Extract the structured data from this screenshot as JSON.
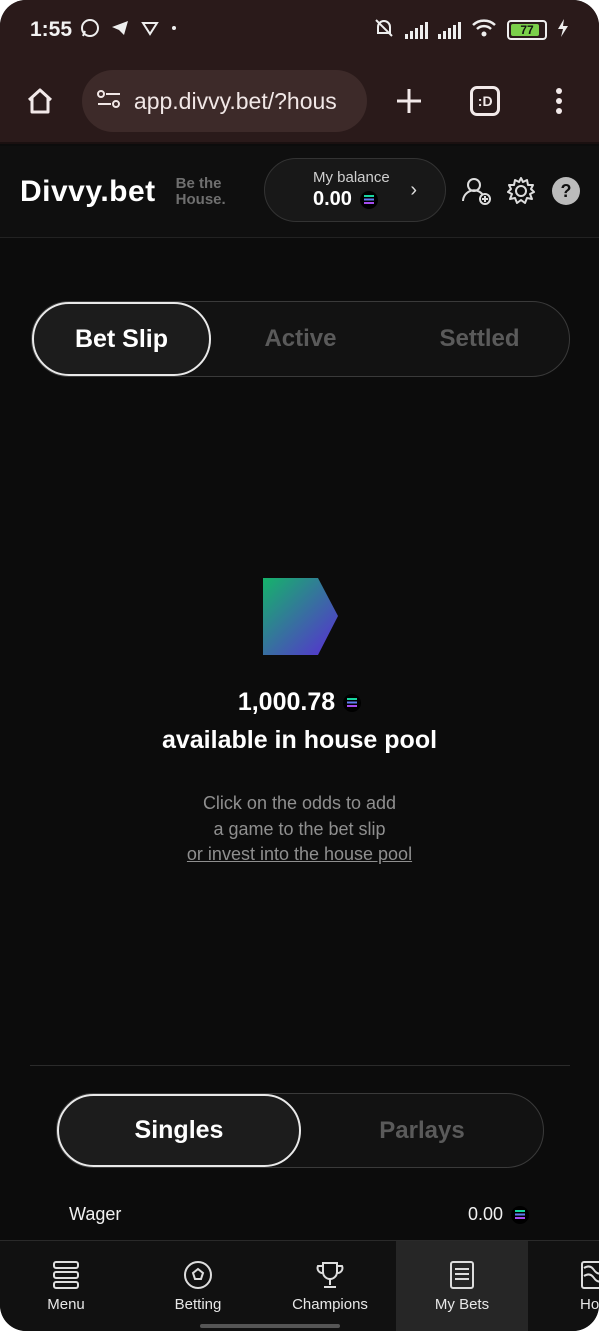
{
  "status_bar": {
    "time": "1:55",
    "battery": "77"
  },
  "browser": {
    "url": "app.divvy.bet/?hous",
    "tab_count_label": ":D"
  },
  "header": {
    "logo": "Divvy.bet",
    "tagline": "Be the House.",
    "balance_label": "My balance",
    "balance_value": "0.00"
  },
  "tabs": {
    "items": [
      "Bet Slip",
      "Active",
      "Settled"
    ],
    "active": "Bet Slip"
  },
  "pool": {
    "amount": "1,000.78",
    "caption": "available in house pool",
    "hint_line1": "Click on the odds to add",
    "hint_line2": "a game to the bet slip",
    "invest_link": "or invest into the house pool"
  },
  "bet_type": {
    "items": [
      "Singles",
      "Parlays"
    ],
    "active": "Singles"
  },
  "wager": {
    "label": "Wager",
    "value": "0.00"
  },
  "bottom_nav": {
    "items": [
      "Menu",
      "Betting",
      "Champions",
      "My Bets",
      "Hou"
    ],
    "active": "My Bets"
  },
  "colors": {
    "background": "#0c0c0c",
    "browser_chrome": "#2a1a1a",
    "accent_gradient_start": "#1aa36b",
    "accent_gradient_end": "#5a2bd6"
  }
}
